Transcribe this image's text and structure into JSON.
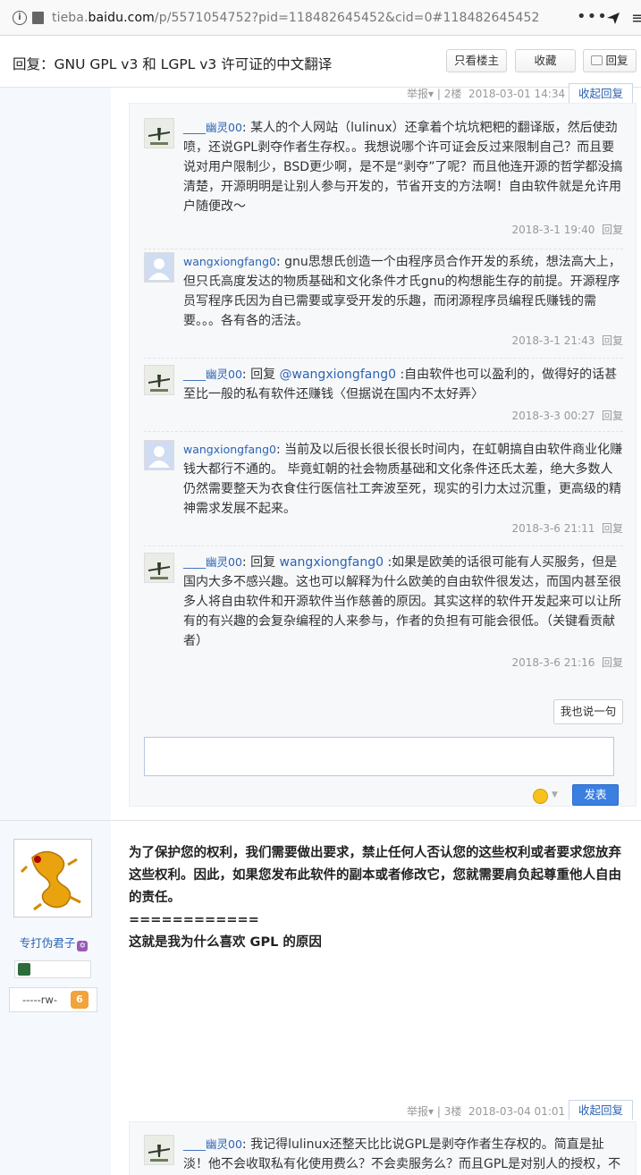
{
  "browser": {
    "url_prefix": "tieba.",
    "url_domain": "baidu.com",
    "url_path": "/p/5571054752?pid=118482645452&cid=0#118482645452",
    "more_icon": "ellipsis-icon",
    "menu_icon": "hamburger-icon"
  },
  "titlebar": {
    "title": "回复：GNU GPL v3 和 LGPL v3 许可证的中文翻译",
    "only_op": "只看楼主",
    "favorite": "收藏",
    "reply": "回复"
  },
  "post2": {
    "report": "举报",
    "floor": "2楼",
    "time": "2018-03-01 14:34",
    "retract": "收起回复"
  },
  "subposts": [
    {
      "user": "____幽灵00",
      "colon": ": ",
      "pre": "",
      "at": "",
      "text": "某人的个人网站（lulinux）还拿着个坑坑粑粑的翻译版，然后使劲喷，还说GPL剥夺作者生存权。。我想说哪个许可证会反过来限制自己？而且要说对用户限制少，BSD更少啊，是不是“剥夺”了呢？而且他连开源的哲学都没搞清楚，开源明明是让别人参与开发的，节省开支的方法啊！自由软件就是允许用户随便改～",
      "time": "2018-3-1 19:40",
      "reply": "回复"
    },
    {
      "user": "wangxiongfang0",
      "colon": ": ",
      "pre": "",
      "at": "",
      "text": "gnu思想氏创造一个由程序员合作开发的系统，想法高大上，但只氏高度发达的物质基础和文化条件才氏gnu的构想能生存的前提。开源程序员写程序氏因为自已需要或享受开发的乐趣，而闭源程序员编程氏赚钱的需要。。。各有各的活法。",
      "time": "2018-3-1 21:43",
      "reply": "回复"
    },
    {
      "user": "____幽灵00",
      "colon": ": ",
      "pre": "回复 ",
      "at": "@wangxiongfang0",
      "text": " :自由软件也可以盈利的，做得好的话甚至比一般的私有软件还赚钱〈但据说在国内不太好弄〉",
      "time": "2018-3-3 00:27",
      "reply": "回复"
    },
    {
      "user": "wangxiongfang0",
      "colon": ": ",
      "pre": "",
      "at": "",
      "text": "当前及以后很长很长很长时间内，在虹朝搞自由软件商业化赚钱大都行不通的。 毕竟虹朝的社会物质基础和文化条件还氏太差，绝大多数人仍然需要整天为衣食住行医信社工奔波至死，现实的引力太过沉重，更高级的精神需求发展不起来。",
      "time": "2018-3-6 21:11",
      "reply": "回复"
    },
    {
      "user": "____幽灵00",
      "colon": ": ",
      "pre": "回复 ",
      "at": "wangxiongfang0",
      "text": " :如果是欧美的话很可能有人买服务，但是国内大多不感兴趣。这也可以解释为什么欧美的自由软件很发达，而国内甚至很多人将自由软件和开源软件当作慈善的原因。其实这样的软件开发起来可以让所有的有兴趣的会复杂编程的人来参与，作者的负担有可能会很低。（关键看贡献者）",
      "time": "2018-3-6 21:16",
      "reply": "回复"
    }
  ],
  "lzl_controls": {
    "say": "我也说一句",
    "send": "发表",
    "emoji_icon": "smiley-icon"
  },
  "post3_author": {
    "name": "专打伪君子",
    "zodiac_icon": "zodiac-icon",
    "level_name": "-----rw-",
    "level": "6"
  },
  "post3_content": {
    "p1": "为了保护您的权利，我们需要做出要求，禁止任何人否认您的这些权利或者要求您放弃这些权利。因此，如果您发布此软件的副本或者修改它，您就需要肩负起尊重他人自由的责任。",
    "p2": "============",
    "p3": "这就是我为什么喜欢 GPL 的原因"
  },
  "post3": {
    "report": "举报",
    "floor": "3楼",
    "time": "2018-03-04 01:01",
    "retract": "收起回复"
  },
  "post3_sub": {
    "user": "____幽灵00",
    "colon": ": ",
    "text": "我记得lulinux还整天比比说GPL是剥夺作者生存权的。简直是扯淡！他不会收取私有化使用费么？不会卖服务么？而且GPL是对别人的授权，不是对"
  },
  "colors": {
    "link": "#2d64b3",
    "sidebar": "#f5f8fd",
    "send_button": "#3b7fe0"
  }
}
